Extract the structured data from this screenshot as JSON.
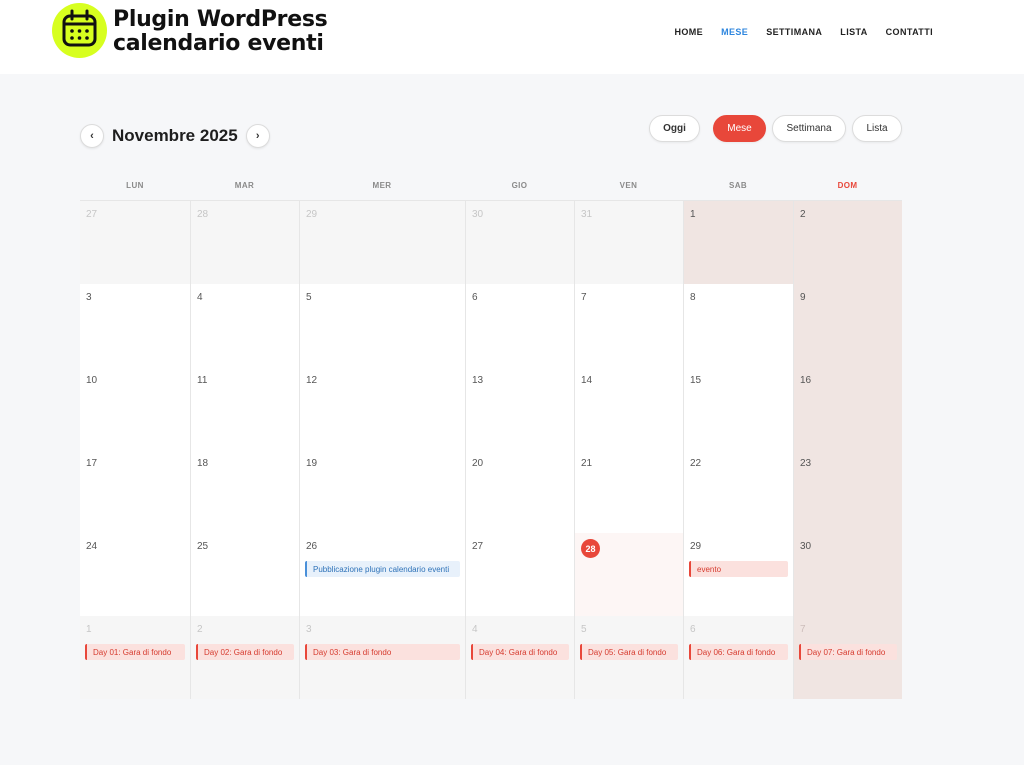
{
  "header": {
    "brand_line1": "Plugin WordPress",
    "brand_line2": "calendario eventi",
    "logo_icon": "calendar-icon",
    "nav": [
      {
        "label": "HOME",
        "active": false
      },
      {
        "label": "MESE",
        "active": true
      },
      {
        "label": "SETTIMANA",
        "active": false
      },
      {
        "label": "LISTA",
        "active": false
      },
      {
        "label": "CONTATTI",
        "active": false
      }
    ]
  },
  "toolbar": {
    "prev_label": "‹",
    "next_label": "›",
    "title": "Novembre 2025",
    "today_label": "Oggi",
    "views": [
      "Mese",
      "Settimana",
      "Lista"
    ],
    "active_view": "Mese"
  },
  "calendar": {
    "weekdays": [
      "LUN",
      "MAR",
      "MER",
      "GIO",
      "VEN",
      "SAB",
      "DOM"
    ],
    "weeks": [
      [
        {
          "day": "27",
          "other": true
        },
        {
          "day": "28",
          "other": true
        },
        {
          "day": "29",
          "other": true
        },
        {
          "day": "30",
          "other": true
        },
        {
          "day": "31",
          "other": true
        },
        {
          "day": "1",
          "other": false
        },
        {
          "day": "2",
          "other": false
        }
      ],
      [
        {
          "day": "3"
        },
        {
          "day": "4"
        },
        {
          "day": "5"
        },
        {
          "day": "6"
        },
        {
          "day": "7"
        },
        {
          "day": "8"
        },
        {
          "day": "9"
        }
      ],
      [
        {
          "day": "10"
        },
        {
          "day": "11"
        },
        {
          "day": "12"
        },
        {
          "day": "13"
        },
        {
          "day": "14"
        },
        {
          "day": "15"
        },
        {
          "day": "16"
        }
      ],
      [
        {
          "day": "17"
        },
        {
          "day": "18"
        },
        {
          "day": "19"
        },
        {
          "day": "20"
        },
        {
          "day": "21"
        },
        {
          "day": "22"
        },
        {
          "day": "23"
        }
      ],
      [
        {
          "day": "24"
        },
        {
          "day": "25"
        },
        {
          "day": "26",
          "event": {
            "label": "Pubblicazione plugin calendario eventi",
            "color": "blue"
          }
        },
        {
          "day": "27"
        },
        {
          "day": "28",
          "today": true
        },
        {
          "day": "29",
          "event": {
            "label": "evento",
            "color": "red"
          }
        },
        {
          "day": "30"
        }
      ],
      [
        {
          "day": "1",
          "other": true,
          "event": {
            "label": "Day 01: Gara di fondo",
            "color": "red"
          }
        },
        {
          "day": "2",
          "other": true,
          "event": {
            "label": "Day 02: Gara di fondo",
            "color": "red"
          }
        },
        {
          "day": "3",
          "other": true,
          "event": {
            "label": "Day 03: Gara di fondo",
            "color": "red"
          }
        },
        {
          "day": "4",
          "other": true,
          "event": {
            "label": "Day 04: Gara di fondo",
            "color": "red"
          }
        },
        {
          "day": "5",
          "other": true,
          "event": {
            "label": "Day 05: Gara di fondo",
            "color": "red"
          }
        },
        {
          "day": "6",
          "other": true,
          "event": {
            "label": "Day 06: Gara di fondo",
            "color": "red"
          }
        },
        {
          "day": "7",
          "other": true,
          "event": {
            "label": "Day 07: Gara di fondo",
            "color": "red"
          }
        }
      ]
    ]
  },
  "colors": {
    "accent": "#e8473a",
    "nav_active": "#2e86de",
    "weekend_shade": "#f0e5e2",
    "logo_bg": "#d7ff1f"
  }
}
